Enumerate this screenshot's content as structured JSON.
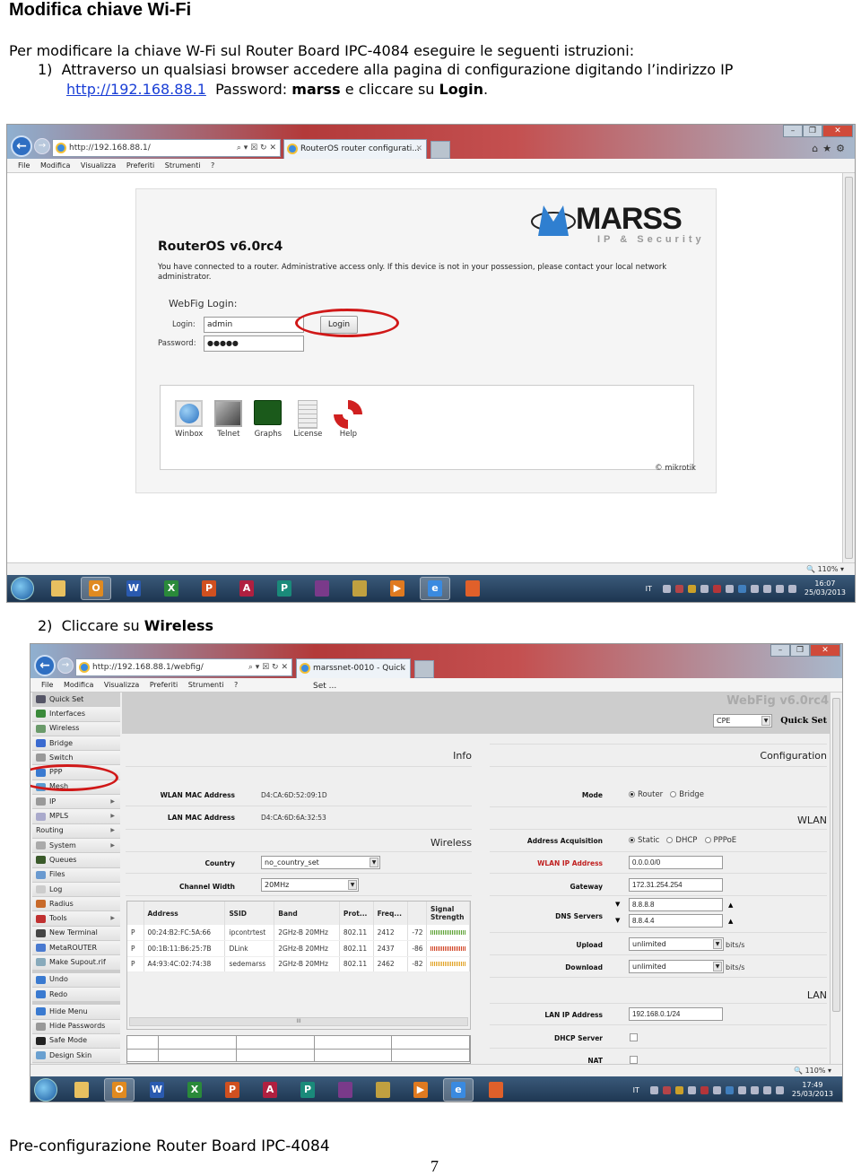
{
  "document": {
    "title": "Modifica chiave Wi-Fi",
    "intro": "Per modificare la chiave W-Fi sul Router Board IPC-4084 eseguire le seguenti istruzioni:",
    "step1": {
      "number": "1)",
      "text": "Attraverso un qualsiasi browser accedere alla pagina di configurazione digitando l’indirizzo IP",
      "link": "http://192.168.88.1",
      "password_label": "Password:",
      "password_value": "marss",
      "tail_pre": "e cliccare su",
      "tail_bold": "Login",
      "tail_end": "."
    },
    "step2": {
      "number": "2)",
      "text": "Cliccare su",
      "bold": "Wireless"
    },
    "footer": "Pre-configurazione Router Board IPC-4084",
    "page_number": "7"
  },
  "screenshot1": {
    "address": "http://192.168.88.1/",
    "address_host": "192.168.88.1",
    "address_controls": "⌕ ▾ ☒ ↻ ✕",
    "tab_title": "RouterOS router configurati...",
    "menu": [
      "File",
      "Modifica",
      "Visualizza",
      "Preferiti",
      "Strumenti",
      "?"
    ],
    "zoom": "110%",
    "login_page": {
      "brand": "MARSS",
      "brand_sub": "IP & Security",
      "heading": "RouterOS v6.0rc4",
      "notice": "You have connected to a router. Administrative access only. If this device is not in your possession, please contact your local network administrator.",
      "webfig_login": "WebFig Login:",
      "login_label": "Login:",
      "login_value": "admin",
      "password_label": "Password:",
      "password_value": "●●●●●",
      "login_button": "Login",
      "tools": [
        {
          "label": "Winbox",
          "icon": "winbox-icon"
        },
        {
          "label": "Telnet",
          "icon": "telnet-icon"
        },
        {
          "label": "Graphs",
          "icon": "graphs-icon"
        },
        {
          "label": "License",
          "icon": "license-icon"
        },
        {
          "label": "Help",
          "icon": "help-icon"
        }
      ],
      "copyright": "© mikrotik"
    },
    "clock_time": "16:07",
    "clock_date": "25/03/2013",
    "lang": "IT"
  },
  "screenshot2": {
    "address": "http://192.168.88.1/webfig/",
    "tab_title": "marssnet-0010 - Quick Set ...",
    "menu": [
      "File",
      "Modifica",
      "Visualizza",
      "Preferiti",
      "Strumenti",
      "?"
    ],
    "zoom": "110%",
    "webfig_version": "WebFig v6.0rc4",
    "mode_select": "CPE",
    "quick_set_label": "Quick Set",
    "sidebar": [
      {
        "label": "Quick Set",
        "arrow": false,
        "color": "#556"
      },
      {
        "label": "Interfaces",
        "arrow": false,
        "color": "#3a8a3a"
      },
      {
        "label": "Wireless",
        "arrow": false,
        "color": "#6a9a6a"
      },
      {
        "label": "Bridge",
        "arrow": false,
        "color": "#3a6ad0"
      },
      {
        "label": "Switch",
        "arrow": false,
        "color": "#999"
      },
      {
        "label": "PPP",
        "arrow": false,
        "color": "#3a7ad0"
      },
      {
        "label": "Mesh",
        "arrow": false,
        "color": "#5a9ad0"
      },
      {
        "label": "IP",
        "arrow": true,
        "color": "#999"
      },
      {
        "label": "MPLS",
        "arrow": true,
        "color": "#aac"
      },
      {
        "label": "Routing",
        "arrow": true,
        "color": null
      },
      {
        "label": "System",
        "arrow": true,
        "color": "#aaa"
      },
      {
        "label": "Queues",
        "arrow": false,
        "color": "#3a5a2a"
      },
      {
        "label": "Files",
        "arrow": false,
        "color": "#6a9ad0"
      },
      {
        "label": "Log",
        "arrow": false,
        "color": "#ccc"
      },
      {
        "label": "Radius",
        "arrow": false,
        "color": "#c86a2a"
      },
      {
        "label": "Tools",
        "arrow": true,
        "color": "#c03030"
      },
      {
        "label": "New Terminal",
        "arrow": false,
        "color": "#444"
      },
      {
        "label": "MetaROUTER",
        "arrow": false,
        "color": "#4a7ad0"
      },
      {
        "label": "Make Supout.rif",
        "arrow": false,
        "color": "#8ab"
      },
      {
        "label": "Undo",
        "arrow": false,
        "color": "#3a7ad0"
      },
      {
        "label": "Redo",
        "arrow": false,
        "color": "#3a7ad0"
      },
      {
        "label": "Hide Menu",
        "arrow": false,
        "color": "#3a7ad0"
      },
      {
        "label": "Hide Passwords",
        "arrow": false,
        "color": "#999"
      },
      {
        "label": "Safe Mode",
        "arrow": false,
        "color": "#222"
      },
      {
        "label": "Design Skin",
        "arrow": false,
        "color": "#6aa0d0"
      }
    ],
    "info": {
      "title": "Info",
      "wlan_mac_label": "WLAN MAC Address",
      "wlan_mac": "D4:CA:6D:52:09:1D",
      "lan_mac_label": "LAN MAC Address",
      "lan_mac": "D4:CA:6D:6A:32:53"
    },
    "wireless": {
      "title": "Wireless",
      "country_label": "Country",
      "country": "no_country_set",
      "channel_width_label": "Channel Width",
      "channel_width": "20MHz"
    },
    "scan_table": {
      "headers": [
        "",
        "Address",
        "SSID",
        "Band",
        "Prot...",
        "Freq...",
        "",
        "Signal Strength"
      ],
      "rows": [
        {
          "flag": "P",
          "address": "00:24:B2:FC:5A:66",
          "ssid": "ipcontrtest",
          "band": "2GHz-B 20MHz",
          "prot": "802.11",
          "freq": "2412",
          "signal": "-72",
          "color": "#5aa030"
        },
        {
          "flag": "P",
          "address": "00:1B:11:B6:25:7B",
          "ssid": "DLink",
          "band": "2GHz-B 20MHz",
          "prot": "802.11",
          "freq": "2437",
          "signal": "-86",
          "color": "#d04020"
        },
        {
          "flag": "P",
          "address": "A4:93:4C:02:74:38",
          "ssid": "sedemarss",
          "band": "2GHz-B 20MHz",
          "prot": "802.11",
          "freq": "2462",
          "signal": "-82",
          "color": "#e0a020"
        }
      ],
      "scroll_grip": "III"
    },
    "configuration": {
      "title": "Configuration",
      "mode_label": "Mode",
      "mode_options": [
        "Router",
        "Bridge"
      ],
      "mode_selected": "Router"
    },
    "wlan": {
      "title": "WLAN",
      "acq_label": "Address Acquisition",
      "acq_options": [
        "Static",
        "DHCP",
        "PPPoE"
      ],
      "acq_selected": "Static",
      "wlan_ip_label": "WLAN IP Address",
      "wlan_ip": "0.0.0.0/0",
      "gateway_label": "Gateway",
      "gateway": "172.31.254.254",
      "dns_label": "DNS Servers",
      "dns": [
        "8.8.8.8",
        "8.8.4.4"
      ],
      "upload_label": "Upload",
      "upload": "unlimited",
      "download_label": "Download",
      "download": "unlimited",
      "unit": "bits/s"
    },
    "lan": {
      "title": "LAN",
      "lan_ip_label": "LAN IP Address",
      "lan_ip": "192.168.0.1/24",
      "dhcp_label": "DHCP Server",
      "dhcp_checked": false,
      "nat_label": "NAT",
      "nat_checked": false
    },
    "clock_time": "17:49",
    "clock_date": "25/03/2013",
    "lang": "IT"
  },
  "taskbar_apps": [
    {
      "name": "explorer",
      "letter": "",
      "color": "#e8c060"
    },
    {
      "name": "outlook",
      "letter": "O",
      "color": "#e08a20"
    },
    {
      "name": "word",
      "letter": "W",
      "color": "#2a5ab0"
    },
    {
      "name": "excel",
      "letter": "X",
      "color": "#2a8a3a"
    },
    {
      "name": "powerpoint",
      "letter": "P",
      "color": "#d05020"
    },
    {
      "name": "access",
      "letter": "A",
      "color": "#b02040"
    },
    {
      "name": "publisher",
      "letter": "P",
      "color": "#1a8a7a"
    },
    {
      "name": "winrar",
      "letter": "",
      "color": "#7a3a8a"
    },
    {
      "name": "archive",
      "letter": "",
      "color": "#c0a040"
    },
    {
      "name": "media",
      "letter": "▶",
      "color": "#e07a20"
    },
    {
      "name": "internet-explorer",
      "letter": "e",
      "color": "#3a8ae0"
    },
    {
      "name": "firefox",
      "letter": "",
      "color": "#e0602a"
    }
  ]
}
